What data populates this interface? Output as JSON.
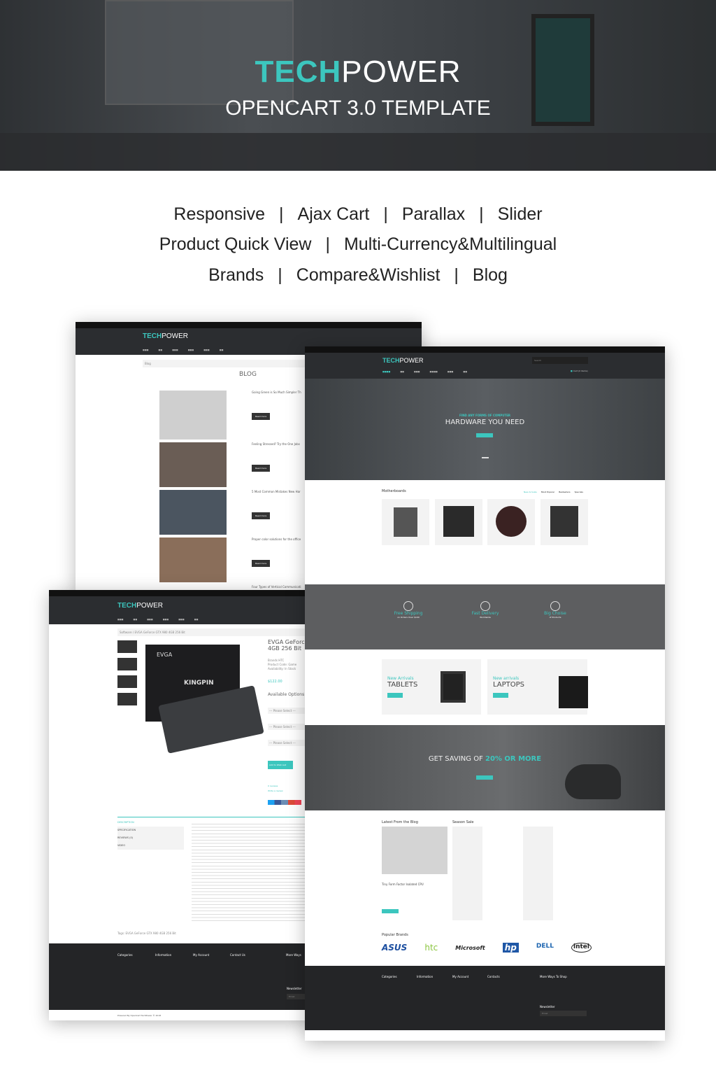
{
  "hero": {
    "brand_accent": "TECH",
    "brand_rest": "POWER",
    "subtitle": "OPENCART 3.0 TEMPLATE",
    "accent_color": "#3cc6be"
  },
  "features": [
    [
      "Responsive",
      "Ajax Cart",
      "Parallax",
      "Slider"
    ],
    [
      "Product Quick View",
      "Multi-Currency&Multilingual"
    ],
    [
      "Brands",
      "Compare&Wishlist",
      "Blog"
    ]
  ],
  "separator": "|",
  "blog_page": {
    "logo_accent": "TECH",
    "logo_rest": "POWER",
    "breadcrumb": "Blog",
    "title": "BLOG",
    "posts": [
      "Going Green is So Much Simpler Th",
      "Feeling Stressed? Try the One Jobs",
      "5 Most Common Mistakes New Har",
      "Proper color solutions for the office",
      "Four Types of Vertical Communicati"
    ],
    "read_more": "Read more"
  },
  "product_page": {
    "logo_accent": "TECH",
    "logo_rest": "POWER",
    "breadcrumb": "Software / EVGA GeForce GTX 980 4GB 256 Bit",
    "product_title": "EVGA GeForce 4GB 256 Bit",
    "box_brand": "EVGA",
    "box_model": "KINGPIN",
    "meta": [
      "Brands HTC",
      "Product Code: Game",
      "Availability: In Stock"
    ],
    "price": "$122.00",
    "options_title": "Available Options",
    "select_placeholder": "--- Please Select ---",
    "add_button": "Add to Wish List",
    "reviews": "0 reviews",
    "write_review": "Write a review",
    "tabs": [
      "DESCRIPTION",
      "SPECIFICATION",
      "REVIEWS (0)",
      "VIDEO"
    ],
    "tags": "Tags: EVGA GeForce GTX 980 4GB 256 Bit",
    "footer_cols": [
      "Categories",
      "Information",
      "My Account",
      "Contact Us",
      "More Ways"
    ],
    "newsletter": "Newsletter",
    "email_placeholder": "Email",
    "powered": "Powered By OpenCart TechPower © 2018"
  },
  "home_page": {
    "logo_accent": "TECH",
    "logo_rest": "POWER",
    "search_placeholder": "Search",
    "cart": "Cart (0 items)",
    "slide_kicker": "FIND ANY FORMS OF COMPUTER",
    "slide_title": "HARDWARE YOU NEED",
    "section_title": "Motherboards",
    "product_tabs": [
      "New Arrivals",
      "Most Popular",
      "Bestsellers",
      "Specials"
    ],
    "benefits": [
      {
        "icon": "shipping-icon",
        "title": "Free Shipping",
        "sub": "on Orders Over $100"
      },
      {
        "icon": "rocket-icon",
        "title": "Fast Delivery",
        "sub": "Worldwide"
      },
      {
        "icon": "box-icon",
        "title": "Big Choise",
        "sub": "of Products"
      }
    ],
    "banners": [
      {
        "kicker": "New Arrivals",
        "title": "TABLETS"
      },
      {
        "kicker": "New arrivals",
        "title": "LAPTOPS"
      }
    ],
    "saving_prefix": "GET SAVING OF ",
    "saving_highlight": "20% OR MORE",
    "blog_title": "Latest From the Blog",
    "blog_post": "Tiny Form Factor Isolated CPU",
    "sale_title": "Season Sale",
    "brands_title": "Popular Brands",
    "brands": [
      "ASUS",
      "htc",
      "Microsoft",
      "hp",
      "DELL",
      "intel"
    ],
    "footer_cols": [
      "Categories",
      "Information",
      "My Account",
      "Contacts",
      "More Ways To Shop"
    ],
    "newsletter": "Newsletter",
    "email_placeholder": "Email"
  }
}
